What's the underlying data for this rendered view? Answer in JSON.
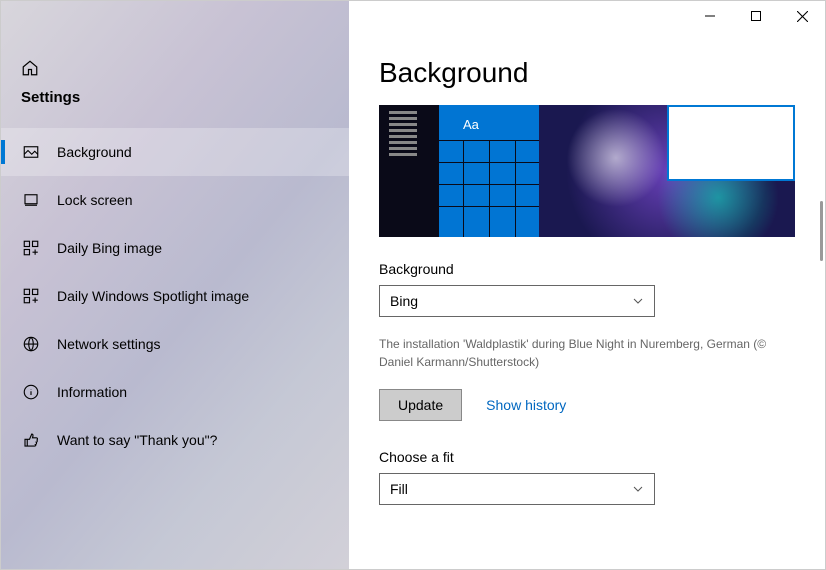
{
  "sidebar": {
    "title": "Settings",
    "items": [
      {
        "label": "Background"
      },
      {
        "label": "Lock screen"
      },
      {
        "label": "Daily Bing image"
      },
      {
        "label": "Daily Windows Spotlight image"
      },
      {
        "label": "Network settings"
      },
      {
        "label": "Information"
      },
      {
        "label": "Want to say \"Thank you\"?"
      }
    ]
  },
  "main": {
    "heading": "Background",
    "preview_sample_text": "Aa",
    "background_section": {
      "label": "Background",
      "value": "Bing"
    },
    "caption": "The installation 'Waldplastik' during Blue Night in Nuremberg, German (© Daniel Karmann/Shutterstock)",
    "update_button": "Update",
    "show_history": "Show history",
    "fit_section": {
      "label": "Choose a fit",
      "value": "Fill"
    }
  }
}
